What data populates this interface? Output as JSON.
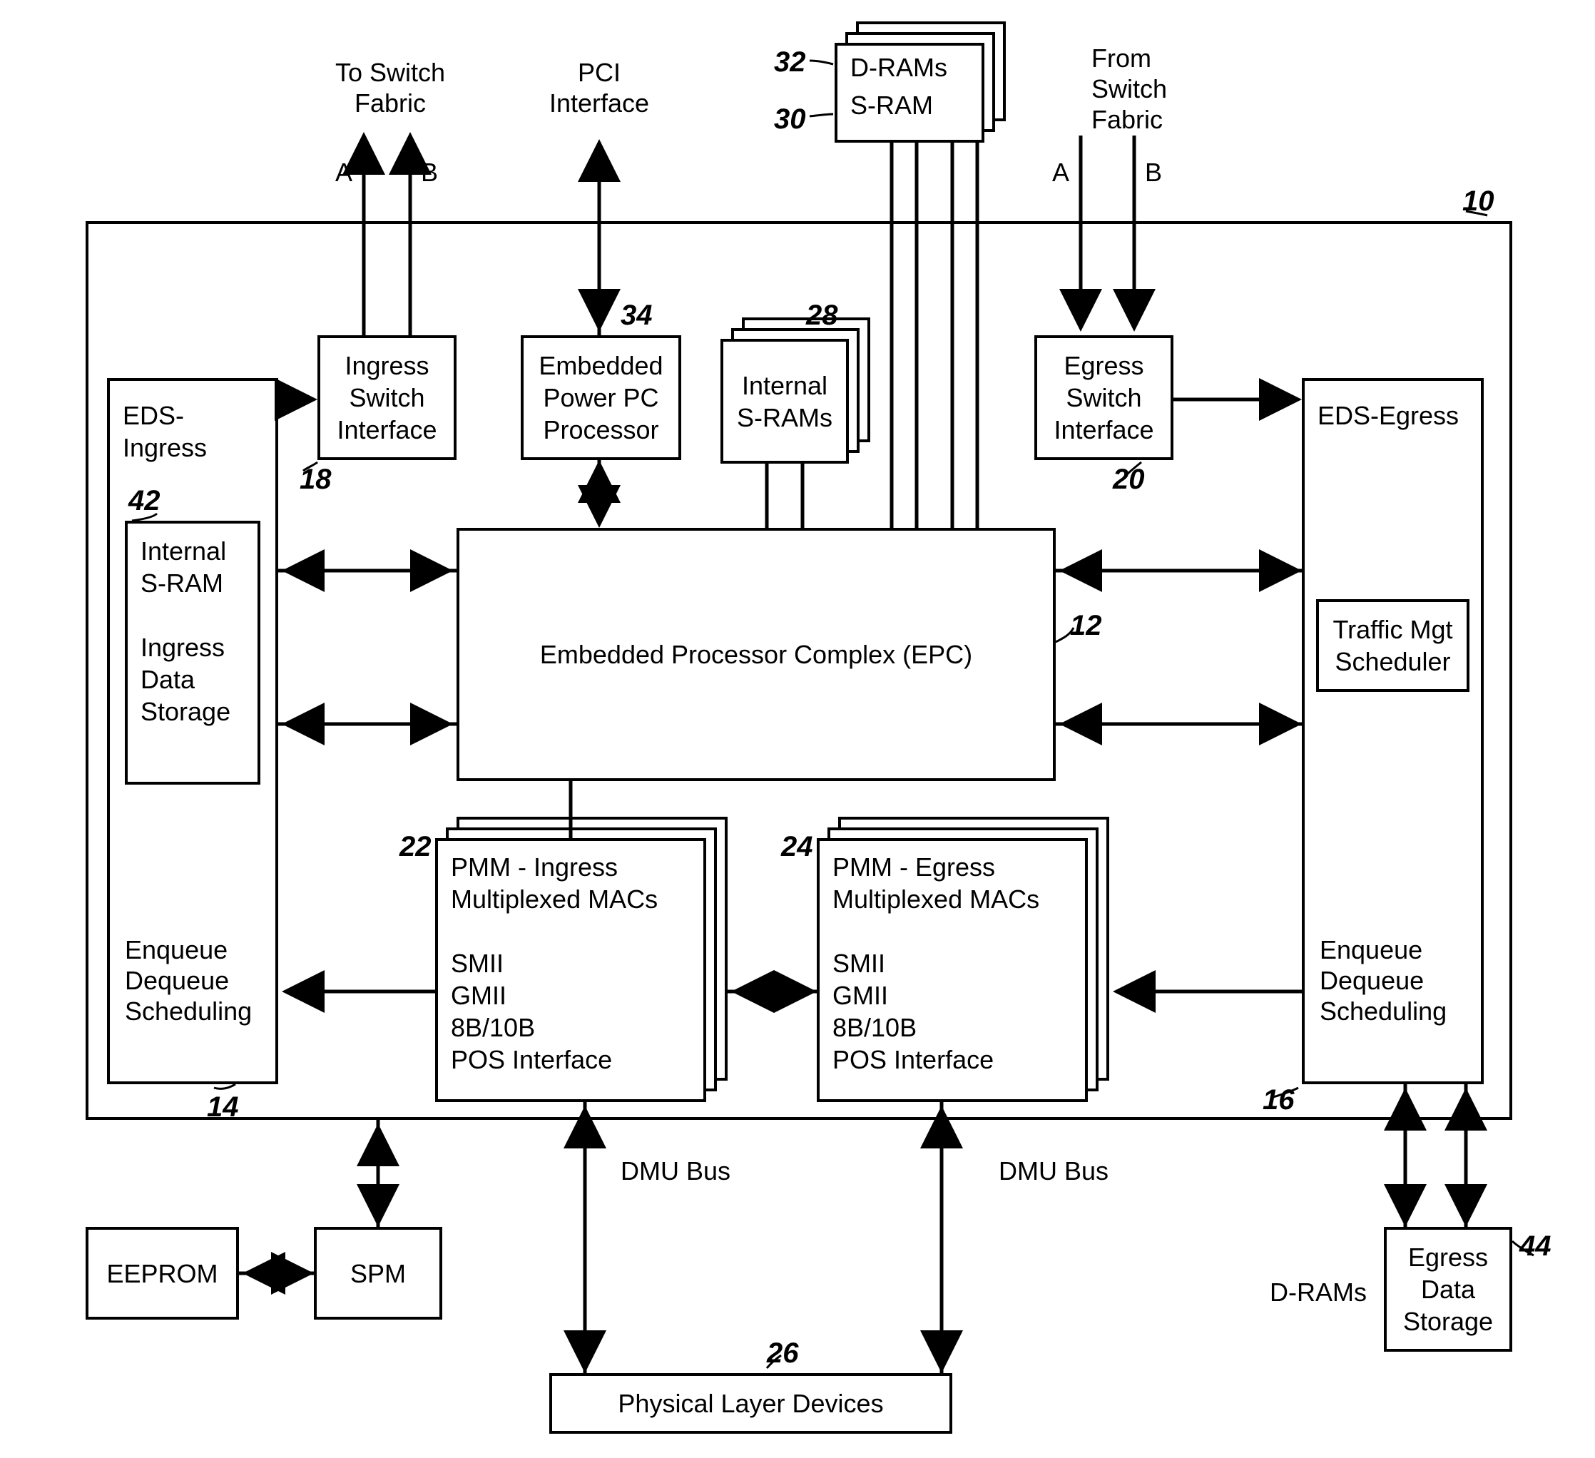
{
  "refs": {
    "r10": "10",
    "r12": "12",
    "r14": "14",
    "r16": "16",
    "r18": "18",
    "r20": "20",
    "r22": "22",
    "r24": "24",
    "r26": "26",
    "r28": "28",
    "r30": "30",
    "r32": "32",
    "r34": "34",
    "r42": "42",
    "r44": "44"
  },
  "labels": {
    "to_switch_fabric": "To Switch\nFabric",
    "from_switch_fabric": "From\nSwitch\nFabric",
    "pci_interface": "PCI\nInterface",
    "A": "A",
    "B": "B",
    "dmu_bus": "DMU Bus",
    "drams_ext": "D-RAMs"
  },
  "blocks": {
    "eds_ingress_title": "EDS-Ingress",
    "eds_ingress_sub": "Internal\nS-RAM\n\nIngress\nData\nStorage",
    "eds_ingress_bottom": "Enqueue\nDequeue\nScheduling",
    "ingress_switch_if": "Ingress\nSwitch\nInterface",
    "embedded_ppc": "Embedded\nPower PC\nProcessor",
    "internal_srams": "Internal\nS-RAMs",
    "drams": "D-RAMs",
    "sram": "S-RAM",
    "egress_switch_if": "Egress\nSwitch\nInterface",
    "eds_egress_title": "EDS-Egress",
    "traffic_mgt": "Traffic Mgt\nScheduler",
    "eds_egress_bottom": "Enqueue\nDequeue\nScheduling",
    "epc": "Embedded Processor Complex (EPC)",
    "pmm_ingress": "PMM - Ingress\nMultiplexed MACs\n\nSMII\nGMII\n8B/10B\nPOS Interface",
    "pmm_egress": "PMM - Egress\nMultiplexed MACs\n\nSMII\nGMII\n8B/10B\nPOS Interface",
    "phys_layer": "Physical Layer Devices",
    "eeprom": "EEPROM",
    "spm": "SPM",
    "egress_data_storage": "Egress\nData\nStorage"
  }
}
